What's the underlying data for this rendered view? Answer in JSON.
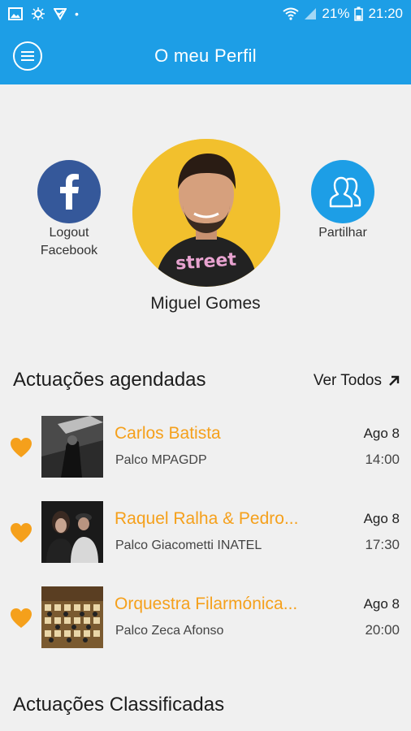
{
  "status_bar": {
    "battery": "21%",
    "time": "21:20"
  },
  "header": {
    "title": "O meu Perfil",
    "menu_icon": "menu-icon"
  },
  "profile": {
    "facebook_label_line1": "Logout",
    "facebook_label_line2": "Facebook",
    "share_label": "Partilhar",
    "name": "Miguel Gomes"
  },
  "scheduled": {
    "title": "Actuações agendadas",
    "see_all": "Ver Todos",
    "items": [
      {
        "title": "Carlos Batista",
        "stage": "Palco MPAGDP",
        "date": "Ago 8",
        "time": "14:00"
      },
      {
        "title": "Raquel Ralha & Pedro...",
        "stage": "Palco Giacometti INATEL",
        "date": "Ago 8",
        "time": "17:30"
      },
      {
        "title": "Orquestra Filarmónica...",
        "stage": "Palco Zeca Afonso",
        "date": "Ago 8",
        "time": "20:00"
      }
    ]
  },
  "rated": {
    "title": "Actuações Classificadas"
  },
  "colors": {
    "primary": "#1d9ee6",
    "accent": "#f5a01b",
    "facebook": "#35589a",
    "avatar_bg": "#f2c02d"
  }
}
